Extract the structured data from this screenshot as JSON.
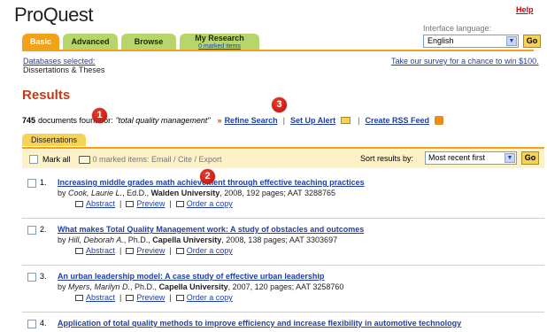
{
  "header": {
    "logo": "ProQuest",
    "help": "Help",
    "interface_language_label": "Interface language:",
    "language_value": "English",
    "go": "Go"
  },
  "tabs": [
    {
      "label": "Basic",
      "active": true
    },
    {
      "label": "Advanced",
      "active": false
    },
    {
      "label": "Browse",
      "active": false
    },
    {
      "label": "My Research",
      "sub": "0 marked items",
      "active": false
    }
  ],
  "databases": {
    "link_label": "Databases selected:",
    "name": "Dissertations & Theses",
    "survey": "Take our survey for a chance to win $100."
  },
  "results": {
    "title": "Results",
    "count": "745",
    "documents_text": "documents found for:",
    "query": "\"total quality management\"",
    "refine": "Refine Search",
    "set_alert": "Set Up Alert",
    "rss": "Create RSS Feed",
    "sub_tab": "Dissertations",
    "mark_all": "Mark all",
    "marked_items": "0 marked items: Email / Cite / Export",
    "sort_label": "Sort results by:",
    "sort_value": "Most recent first",
    "go": "Go"
  },
  "markers": [
    "1",
    "2",
    "3"
  ],
  "items": [
    {
      "num": "1.",
      "title": "Increasing middle grades math achievement through effective teaching practices",
      "by_prefix": "by",
      "author": "Cook, Laurie L.",
      "degree": ", Ed.D., ",
      "school": "Walden University",
      "details": ", 2008, 192 pages; AAT 3288765",
      "abstract": "Abstract",
      "preview": "Preview",
      "order": "Order a copy"
    },
    {
      "num": "2.",
      "title": "What makes Total Quality Management work: A study of obstacles and outcomes",
      "by_prefix": "by",
      "author": "Hill, Deborah A.",
      "degree": ", Ph.D., ",
      "school": "Capella University",
      "details": ", 2008, 138 pages; AAT 3303697",
      "abstract": "Abstract",
      "preview": "Preview",
      "order": "Order a copy"
    },
    {
      "num": "3.",
      "title": "An urban leadership model: A case study of effective urban leadership",
      "by_prefix": "by",
      "author": "Myers, Marilyn D.",
      "degree": ", Ph.D., ",
      "school": "Capella University",
      "details": ", 2007, 120 pages; AAT 3258760",
      "abstract": "Abstract",
      "preview": "Preview",
      "order": "Order a copy"
    },
    {
      "num": "4.",
      "title": "Application of total quality methods to improve efficiency and increase flexibility in automotive technology"
    }
  ]
}
